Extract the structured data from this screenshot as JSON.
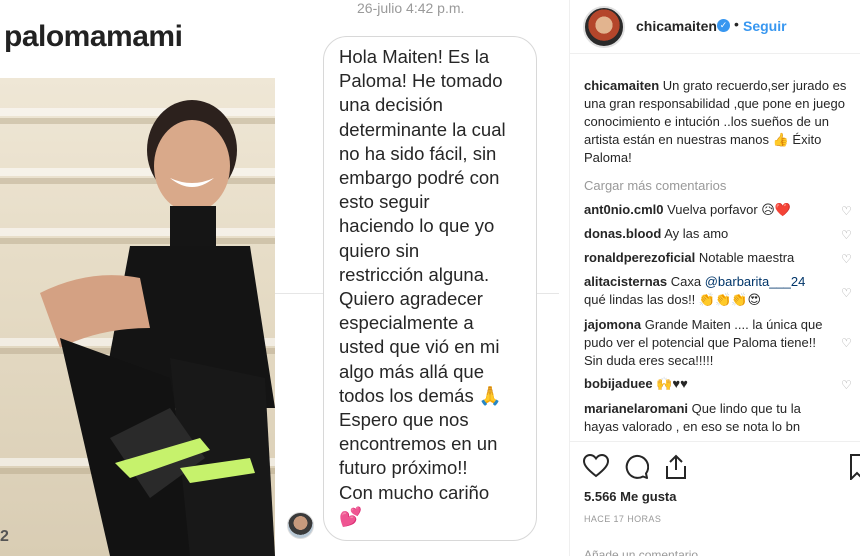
{
  "post": {
    "title": "palomamami",
    "photo_number": "2",
    "chat_date": "26-julio 4:42 p.m.",
    "chat_lines": [
      "Hola Maiten! Es la",
      "Paloma! He tomado",
      "una decisión",
      "determinante la cual",
      "no ha sido fácil, sin",
      "embargo podré con",
      "esto seguir",
      "haciendo lo que yo",
      "quiero sin",
      "restricción alguna.",
      "Quiero agradecer",
      "especialmente a",
      "usted que vió en mi",
      "algo más allá que",
      "todos los demás 🙏",
      "Espero que nos",
      "encontremos en un",
      "futuro próximo!!",
      "Con mucho cariño",
      "💕"
    ]
  },
  "header": {
    "username": "chicamaiten",
    "dot": "•",
    "follow_label": "Seguir"
  },
  "caption": {
    "username": "chicamaiten",
    "text": "Un grato recuerdo,ser jurado es una gran responsabilidad ,que pone en juego conocimiento e intución ..los sueños de un artista están en nuestras manos 👍 Éxito Paloma!"
  },
  "load_more_label": "Cargar más comentarios",
  "comments": [
    {
      "username": "ant0nio.cml0",
      "text": "Vuelva porfavor 😥❤️"
    },
    {
      "username": "donas.blood",
      "text": "Ay las amo"
    },
    {
      "username": "ronaldperezoficial",
      "text": "Notable maestra"
    },
    {
      "username": "alitacisternas",
      "text_before": "Caxa ",
      "mention": "@barbarita___24",
      "text_after": " qué lindas las dos!! 👏👏👏😍"
    },
    {
      "username": "jajomona",
      "text": "Grande Maiten .... la única que pudo ver el potencial que Paloma tiene!! Sin duda eres seca!!!!!"
    },
    {
      "username": "bobijaduee",
      "text": "🙌♥♥"
    },
    {
      "username": "marianelaromani",
      "text": "Que lindo que tu la hayas valorado , en eso se nota lo bn"
    }
  ],
  "actions": {
    "likes": "5.566 Me gusta",
    "time_ago": "HACE 17 HORAS",
    "add_comment_placeholder": "Añade un comentario..."
  },
  "icons": {
    "heart": "♡",
    "verified": "✓"
  }
}
